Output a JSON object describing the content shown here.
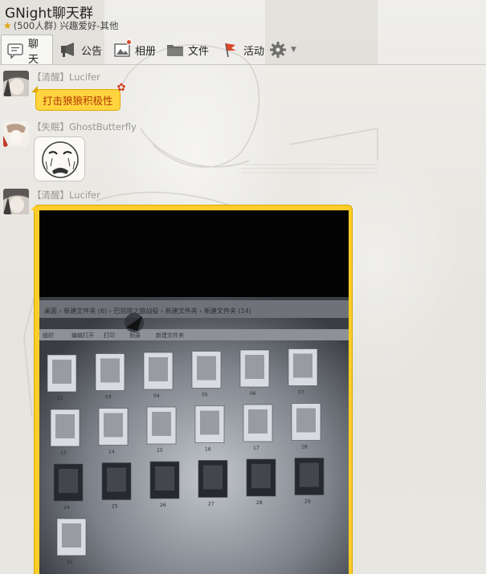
{
  "group": {
    "title": "GNight聊天群",
    "meta": "(500人群) 兴趣爱好-其他",
    "star_icon": "star-icon"
  },
  "toolbar": {
    "tabs": [
      {
        "label": "聊天",
        "icon": "chat-icon",
        "active": true
      },
      {
        "label": "公告",
        "icon": "megaphone-icon",
        "active": false
      },
      {
        "label": "相册",
        "icon": "photo-album-icon",
        "active": false,
        "badge": true
      },
      {
        "label": "文件",
        "icon": "folder-icon",
        "active": false
      },
      {
        "label": "活动",
        "icon": "flag-icon",
        "active": false
      }
    ],
    "settings_icon": "gear-icon"
  },
  "messages": [
    {
      "sender": "【清醒】Lucifer",
      "type": "text",
      "text": "打击狼狼积极性"
    },
    {
      "sender": "【失眠】GhostButterfly",
      "type": "sticker",
      "sticker": "crying-face-sticker"
    },
    {
      "sender": "【清醒】Lucifer",
      "type": "image"
    }
  ],
  "photo": {
    "breadcrumb": "桌面 › 新建文件夹 (6) › 巴别塔之狼战役 › 新建文件夹 › 新建文件夹 (14)",
    "menu": [
      "组织",
      "编辑打开",
      "打印",
      "刻录",
      "新建文件夹"
    ],
    "thumb_labels": [
      "01",
      "03",
      "04",
      "05",
      "06",
      "07",
      "13",
      "14",
      "15",
      "16",
      "17",
      "18",
      "24",
      "25",
      "26",
      "27",
      "28",
      "29",
      "35"
    ]
  },
  "colors": {
    "bubble_yellow": "#ffd43f",
    "bubble_text": "#b23a00",
    "badge_red": "#d64a2b"
  }
}
